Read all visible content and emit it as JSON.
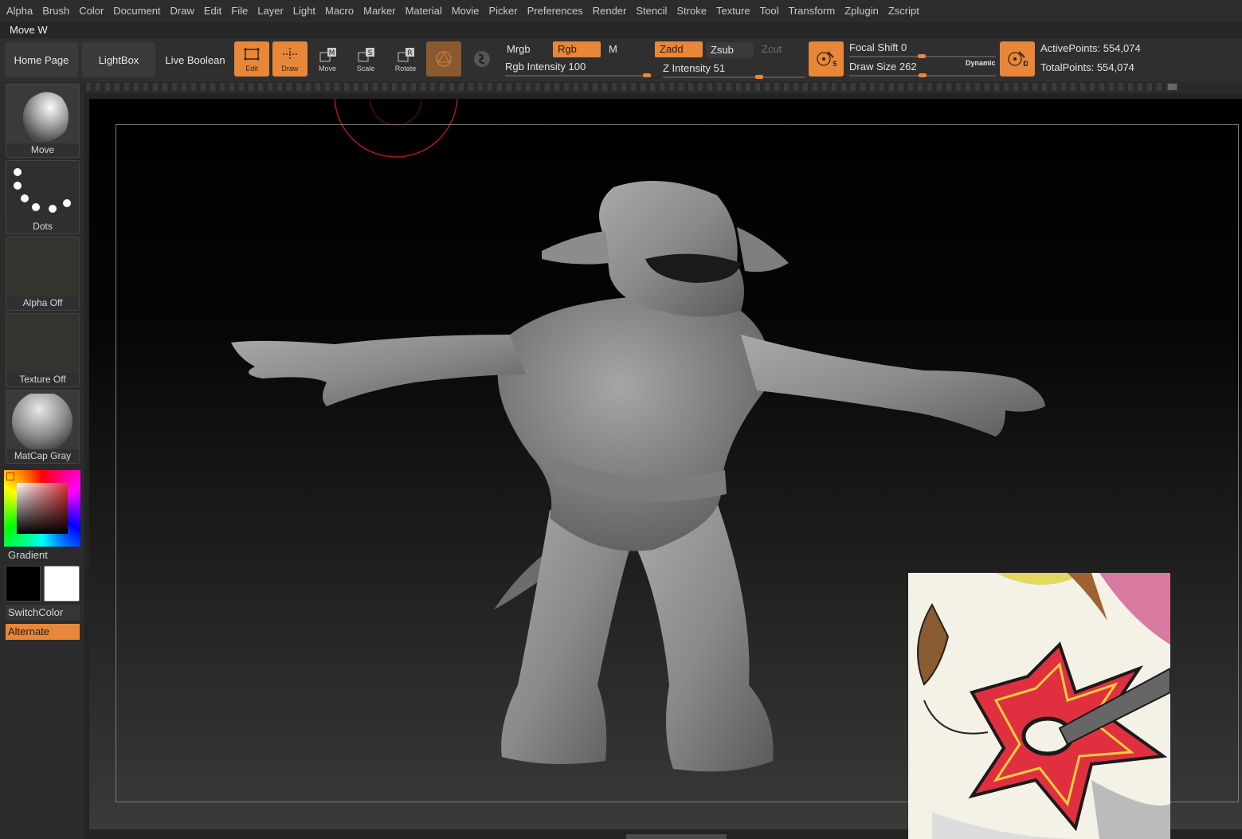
{
  "menu": [
    "Alpha",
    "Brush",
    "Color",
    "Document",
    "Draw",
    "Edit",
    "File",
    "Layer",
    "Light",
    "Macro",
    "Marker",
    "Material",
    "Movie",
    "Picker",
    "Preferences",
    "Render",
    "Stencil",
    "Stroke",
    "Texture",
    "Tool",
    "Transform",
    "Zplugin",
    "Zscript"
  ],
  "tool_title": "Move W",
  "toolbar": {
    "home_page": "Home Page",
    "lightbox": "LightBox",
    "live_boolean": "Live Boolean",
    "edit": "Edit",
    "draw": "Draw",
    "move": "Move",
    "scale": "Scale",
    "rotate": "Rotate",
    "mrgb": "Mrgb",
    "rgb": "Rgb",
    "m": "M",
    "zadd": "Zadd",
    "zsub": "Zsub",
    "zcut": "Zcut",
    "rgb_intensity_label": "Rgb Intensity",
    "rgb_intensity_value": "100",
    "z_intensity_label": "Z Intensity",
    "z_intensity_value": "51",
    "focal_shift_label": "Focal Shift",
    "focal_shift_value": "0",
    "draw_size_label": "Draw Size",
    "draw_size_value": "262",
    "dynamic": "Dynamic",
    "active_points": "ActivePoints: 554,074",
    "total_points": "TotalPoints: 554,074"
  },
  "shelf": {
    "brush": "Move",
    "stroke": "Dots",
    "alpha": "Alpha Off",
    "texture": "Texture Off",
    "material": "MatCap Gray",
    "gradient": "Gradient",
    "switch_color": "SwitchColor",
    "alternate": "Alternate"
  },
  "colors": {
    "accent": "#e8873a",
    "background": "#2b2b2b"
  }
}
